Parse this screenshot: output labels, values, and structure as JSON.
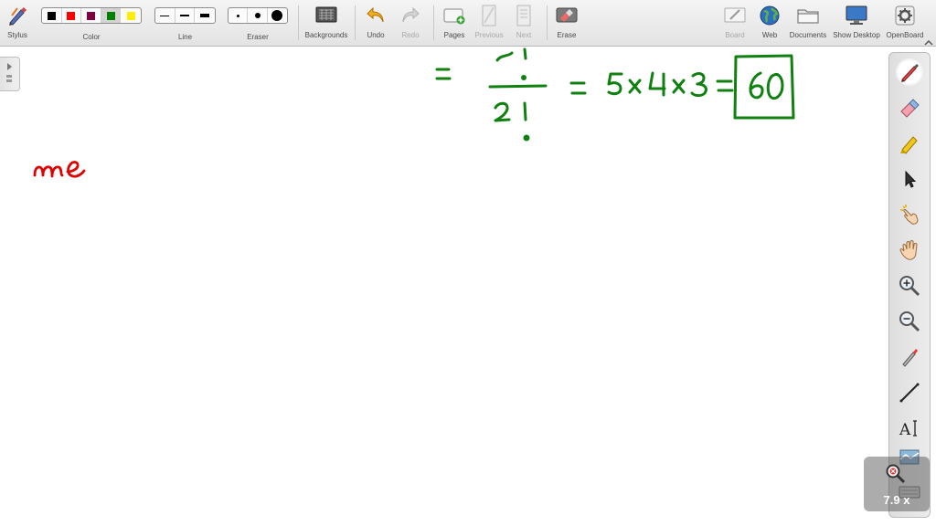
{
  "toolbar": {
    "stylus_label": "Stylus",
    "color_label": "Color",
    "line_label": "Line",
    "eraser_label": "Eraser",
    "backgrounds_label": "Backgrounds",
    "undo_label": "Undo",
    "redo_label": "Redo",
    "pages_label": "Pages",
    "previous_label": "Previous",
    "next_label": "Next",
    "erase_label": "Erase",
    "board_label": "Board",
    "web_label": "Web",
    "documents_label": "Documents",
    "show_desktop_label": "Show Desktop",
    "openboard_label": "OpenBoard",
    "colors": [
      "#000000",
      "#ff0000",
      "#800040",
      "#008000",
      "#ffee00"
    ],
    "selected_color_index": 3
  },
  "right_tools": [
    {
      "name": "pen-tool",
      "icon": "pen-icon",
      "active": true
    },
    {
      "name": "eraser-tool",
      "icon": "eraser-icon"
    },
    {
      "name": "marker-tool",
      "icon": "highlighter-icon"
    },
    {
      "name": "selector-tool",
      "icon": "arrow-pointer-icon"
    },
    {
      "name": "interact-tool",
      "icon": "pointing-hand-icon"
    },
    {
      "name": "hand-tool",
      "icon": "open-hand-icon"
    },
    {
      "name": "zoom-in-tool",
      "icon": "zoom-in-icon"
    },
    {
      "name": "zoom-out-tool",
      "icon": "zoom-out-icon"
    },
    {
      "name": "laser-pointer-tool",
      "icon": "laser-pointer-icon"
    },
    {
      "name": "line-tool",
      "icon": "line-icon"
    },
    {
      "name": "text-tool",
      "icon": "text-icon"
    },
    {
      "name": "capture-tool",
      "icon": "capture-icon"
    },
    {
      "name": "keyboard-tool",
      "icon": "keyboard-icon"
    }
  ],
  "zoom": {
    "value": "7.9 x"
  },
  "board": {
    "ink_green": "#108010",
    "ink_red": "#e00000"
  }
}
